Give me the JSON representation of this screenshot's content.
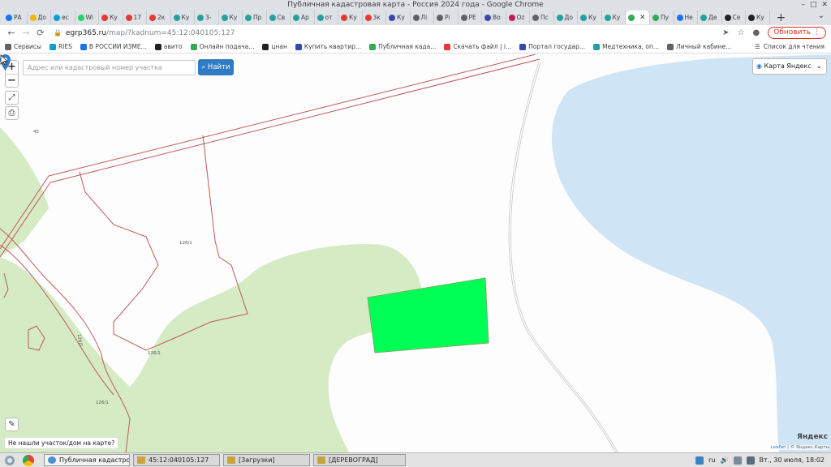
{
  "window": {
    "title": "Публичная кадастровая карта - Россия 2024 года - Google Chrome"
  },
  "tabs": [
    {
      "label": "РА",
      "color": "#1a73e8"
    },
    {
      "label": "До",
      "color": "#f4b400"
    },
    {
      "label": "ec",
      "color": "#00a0d6"
    },
    {
      "label": "Wi",
      "color": "#25d366"
    },
    {
      "label": "Ку",
      "color": "#e53935"
    },
    {
      "label": "17",
      "color": "#e53935"
    },
    {
      "label": "2к",
      "color": "#e53935"
    },
    {
      "label": "Ку",
      "color": "#25a0a0"
    },
    {
      "label": "3-",
      "color": "#25a0a0"
    },
    {
      "label": "Ку",
      "color": "#25a0a0"
    },
    {
      "label": "Пр",
      "color": "#25a0a0"
    },
    {
      "label": "Св",
      "color": "#25a0a0"
    },
    {
      "label": "Ар",
      "color": "#25a0a0"
    },
    {
      "label": "от",
      "color": "#25a0a0"
    },
    {
      "label": "Ку",
      "color": "#e53935"
    },
    {
      "label": "3к",
      "color": "#e53935"
    },
    {
      "label": "Ку",
      "color": "#3949ab"
    },
    {
      "label": "Лі",
      "color": "#5f6368"
    },
    {
      "label": "Рі",
      "color": "#5f6368"
    },
    {
      "label": "РЕ",
      "color": "#5f6368"
    },
    {
      "label": "Во",
      "color": "#3949ab"
    },
    {
      "label": "Оz",
      "color": "#c2185b"
    },
    {
      "label": "Пс",
      "color": "#5f6368"
    },
    {
      "label": "До",
      "color": "#25a0a0"
    },
    {
      "label": "Ку",
      "color": "#25a0a0"
    },
    {
      "label": "Ку",
      "color": "#25a0a0"
    },
    {
      "label": "",
      "color": "#34a853",
      "active": true
    },
    {
      "label": "Пу",
      "color": "#34a853"
    },
    {
      "label": "Не",
      "color": "#1a73e8"
    },
    {
      "label": "Де",
      "color": "#25a0a0"
    },
    {
      "label": "Се",
      "color": "#202124"
    },
    {
      "label": "Ку",
      "color": "#202124"
    }
  ],
  "toolbar": {
    "url_host": "egrp365.ru",
    "url_path": "/map/?kadnum=45:12:040105:127",
    "update_label": "Обновить"
  },
  "bookmarks": {
    "items": [
      {
        "label": "Сервисы",
        "color": "#5f6368"
      },
      {
        "label": "RIES",
        "color": "#00a0d6"
      },
      {
        "label": "В РОССИИ ИЗМЕ...",
        "color": "#1a73e8"
      },
      {
        "label": "авито",
        "color": "#202124"
      },
      {
        "label": "Онлайн подача...",
        "color": "#34a853"
      },
      {
        "label": "цнан",
        "color": "#202124"
      },
      {
        "label": "Купить квартир...",
        "color": "#3949ab"
      },
      {
        "label": "Публичная када...",
        "color": "#34a853"
      },
      {
        "label": "Скачать файл | i...",
        "color": "#e53935"
      },
      {
        "label": "Портал государ...",
        "color": "#3949ab"
      },
      {
        "label": "Медтехника, оп...",
        "color": "#25a0a0"
      },
      {
        "label": "Личный кабине...",
        "color": "#5f6368"
      }
    ],
    "reading_list": "Список для чтения"
  },
  "map": {
    "search_placeholder": "Адрес или кадастровый номер участка",
    "search_button": "Найти",
    "layer": "Карта Яндекс",
    "not_found": "Не нашли участок/дом на карте?",
    "yandex_logo": "Яндекс",
    "attribution_leaflet": "Leaflet",
    "attribution_rest": " | © Яндекс.Карты",
    "plot_labels": [
      "45",
      "126/1",
      "126/1",
      "126/1",
      "126/1"
    ]
  },
  "taskbar": {
    "tasks": [
      {
        "label": "Публичная кадастровая ...",
        "active": true
      },
      {
        "label": "45:12:040105:127",
        "active": false
      },
      {
        "label": "[Загрузки]",
        "active": false
      },
      {
        "label": "[ДЕРЕВОГРАД]",
        "active": false
      }
    ],
    "lang": "ru",
    "clock": "Вт., 30 июля, 18:02"
  },
  "colors": {
    "green_area": "#d5ebc3",
    "water": "#cfe4f5",
    "plot_fill": "#00ff55",
    "boundary": "#c0585a",
    "accent": "#2f7bc4"
  }
}
